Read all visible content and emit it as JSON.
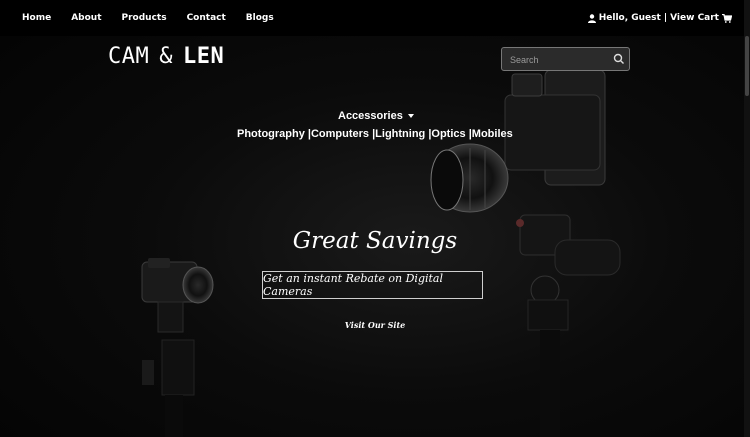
{
  "nav": {
    "links": [
      "Home",
      "About",
      "Products",
      "Contact",
      "Blogs"
    ],
    "user_text": "Hello, Guest",
    "separator": "|",
    "cart_text": "View Cart"
  },
  "brand": {
    "part1": "CAM",
    "amp": "&",
    "part2": "LEN"
  },
  "search": {
    "placeholder": "Search",
    "icon": "search-icon"
  },
  "menu": {
    "toggle_label": "Accessories",
    "items": [
      "Photography |",
      "Computers |",
      "Lightning |",
      "Optics |",
      "Mobiles"
    ]
  },
  "hero": {
    "headline": "Great Savings",
    "rebate": "Get an instant Rebate on Digital Cameras",
    "cta": "Visit Our Site"
  },
  "colors": {
    "background": "#050505",
    "text": "#ffffff",
    "search_bg": "#2b2b2b"
  }
}
